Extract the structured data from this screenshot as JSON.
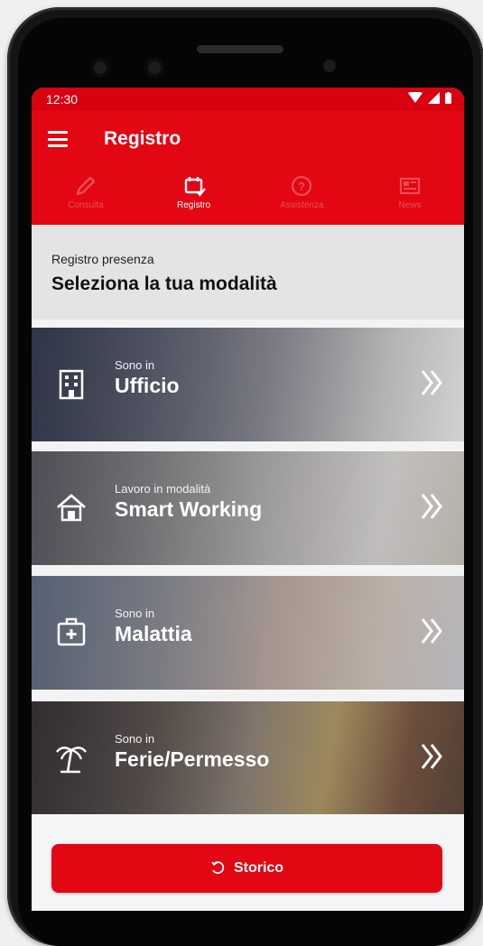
{
  "status_bar": {
    "time": "12:30"
  },
  "app_bar": {
    "title": "Registro"
  },
  "tabs": [
    {
      "label": "Consulta",
      "icon": "pencil-icon",
      "active": false
    },
    {
      "label": "Registro",
      "icon": "calendar-check-icon",
      "active": true
    },
    {
      "label": "Assistenza",
      "icon": "help-icon",
      "active": false
    },
    {
      "label": "News",
      "icon": "news-icon",
      "active": false
    }
  ],
  "header": {
    "subtitle": "Registro presenza",
    "title": "Seleziona la tua modalità"
  },
  "options": [
    {
      "small": "Sono in",
      "big": "Ufficio",
      "icon": "office-building-icon"
    },
    {
      "small": "Lavoro in modalità",
      "big": "Smart Working",
      "icon": "home-icon"
    },
    {
      "small": "Sono in",
      "big": "Malattia",
      "icon": "medical-kit-icon"
    },
    {
      "small": "Sono in",
      "big": "Ferie/Permesso",
      "icon": "palm-tree-icon"
    }
  ],
  "storico_button": {
    "label": "Storico",
    "icon": "history-icon"
  },
  "colors": {
    "brand_red": "#e30613",
    "status_red": "#d90010"
  }
}
